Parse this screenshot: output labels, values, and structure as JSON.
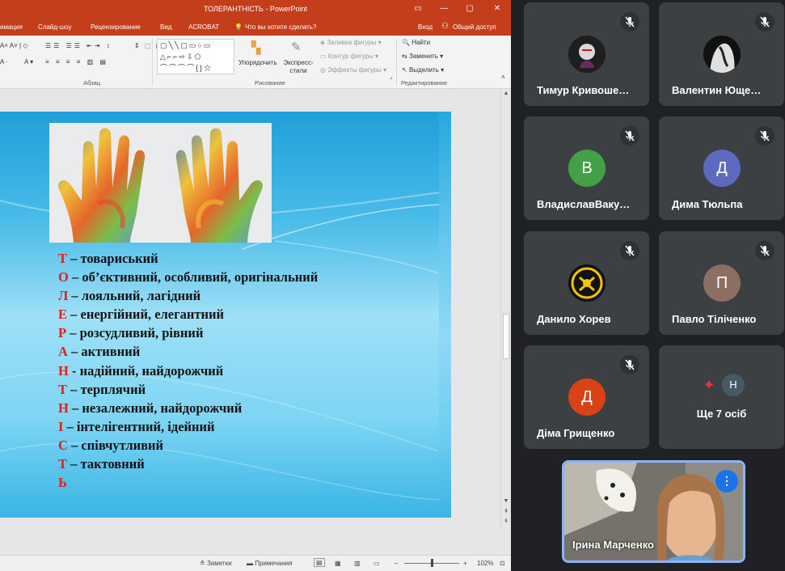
{
  "powerpoint": {
    "window_title": "ТОЛЕРАНТНІСТЬ - PowerPoint",
    "window_buttons": [
      "▭",
      "—",
      "▢",
      "✕"
    ],
    "tabs": [
      "имация",
      "Слайд-шоу",
      "Рецензирование",
      "Вид",
      "ACROBAT"
    ],
    "tell_me": "Что вы хотите сделать?",
    "signin": "Вход",
    "share": "Общий доступ",
    "ribbon": {
      "group_paragraph": "Абзац",
      "group_drawing": "Рисование",
      "group_editing": "Редактирование",
      "arrange": "Упорядочить",
      "quick_styles": "Экспресс-стили",
      "shape_fill": "Заливка фигуры",
      "shape_outline": "Контур фигуры",
      "shape_effects": "Эффекты фигуры",
      "find": "Найти",
      "replace": "Заменить",
      "select": "Выделить",
      "shapes_row1": "▢╲╲▢▭○▭",
      "shapes_row2": "△⌐⌐⇨⇩⬠",
      "shapes_row3": "⌒⌒⌒⌒{}☆"
    },
    "slide": {
      "acrostic": [
        {
          "letter": "Т",
          "text": " – товариський"
        },
        {
          "letter": "О",
          "text": " – об’єктивний, особливий, оригінальний"
        },
        {
          "letter": "Л",
          "text": " – лояльний, лагідний"
        },
        {
          "letter": "Е",
          "text": " – енергійний, елегантний"
        },
        {
          "letter": "Р",
          "text": " – розсудливий, рівний"
        },
        {
          "letter": "А",
          "text": " – активний"
        },
        {
          "letter": "Н",
          "text": " - надійний, найдорожчий"
        },
        {
          "letter": "Т",
          "text": " – терплячий"
        },
        {
          "letter": "Н",
          "text": " – незалежний, найдорожчий"
        },
        {
          "letter": "І",
          "text": " – інтелігентний, ідейний"
        },
        {
          "letter": "С",
          "text": " – співчутливий"
        },
        {
          "letter": "Т",
          "text": " – тактовний"
        },
        {
          "letter": "Ь",
          "text": ""
        }
      ]
    },
    "status": {
      "notes": "Заметки",
      "comments": "Примечания",
      "zoom": "102%"
    }
  },
  "meet": {
    "participants": [
      {
        "name": "Тимур Кривоше…",
        "initial": "",
        "color": "#2a2a2a",
        "photo": true
      },
      {
        "name": "Валентин Юще…",
        "initial": "",
        "color": "#222222",
        "photo": true
      },
      {
        "name": "ВладиславВаку…",
        "initial": "В",
        "color": "#43a047",
        "photo": false
      },
      {
        "name": "Дима Тюльпа",
        "initial": "Д",
        "color": "#5c6bc0",
        "photo": false
      },
      {
        "name": "Данило Хорев",
        "initial": "",
        "color": "#1b1b1b",
        "photo": true
      },
      {
        "name": "Павло Тіліченко",
        "initial": "П",
        "color": "#8d6e63",
        "photo": false
      },
      {
        "name": "Діма Грищенко",
        "initial": "Д",
        "color": "#d84315",
        "photo": false
      }
    ],
    "more": {
      "label": "Ще 7 осіб",
      "initial": "Н",
      "initial_color": "#455a64"
    },
    "self": {
      "name": "Ірина Марченко"
    }
  }
}
